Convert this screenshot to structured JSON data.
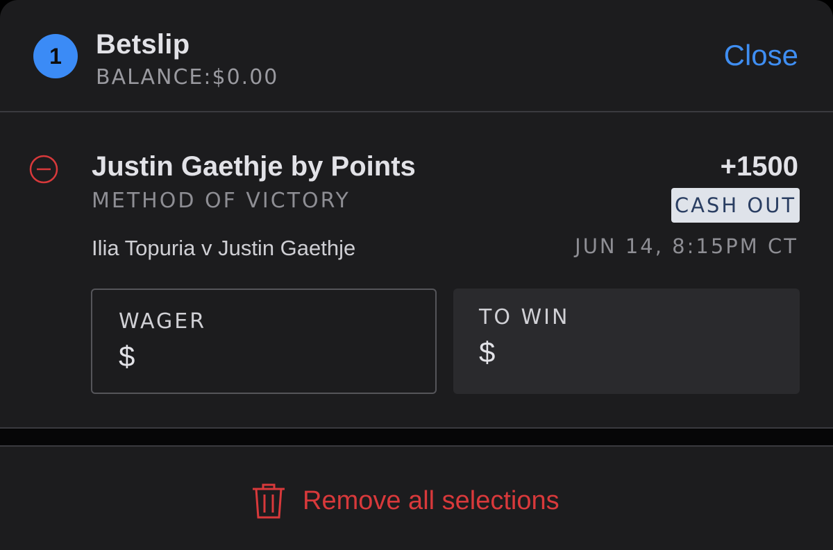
{
  "betslip": {
    "count": "1",
    "title": "Betslip",
    "balance": "BALANCE:$0.00",
    "close_label": "Close"
  },
  "selection": {
    "title": "Justin Gaethje by Points",
    "market": "METHOD OF VICTORY",
    "event": "Ilia Topuria v Justin Gaethje",
    "odds": "+1500",
    "cashout_label": "CASH OUT",
    "event_time": "JUN 14, 8:15PM CT"
  },
  "wager": {
    "label": "WAGER",
    "currency": "$",
    "value": ""
  },
  "to_win": {
    "label": "TO WIN",
    "currency": "$",
    "value": ""
  },
  "footer": {
    "remove_all_label": "Remove all selections"
  },
  "icons": {
    "remove_selection": "minus-circle-icon",
    "remove_all": "trash-icon"
  },
  "colors": {
    "accent_blue": "#3b8bf6",
    "danger_red": "#d8393b",
    "panel_bg": "#1c1c1e",
    "cashout_bg": "#dfe3ea"
  }
}
